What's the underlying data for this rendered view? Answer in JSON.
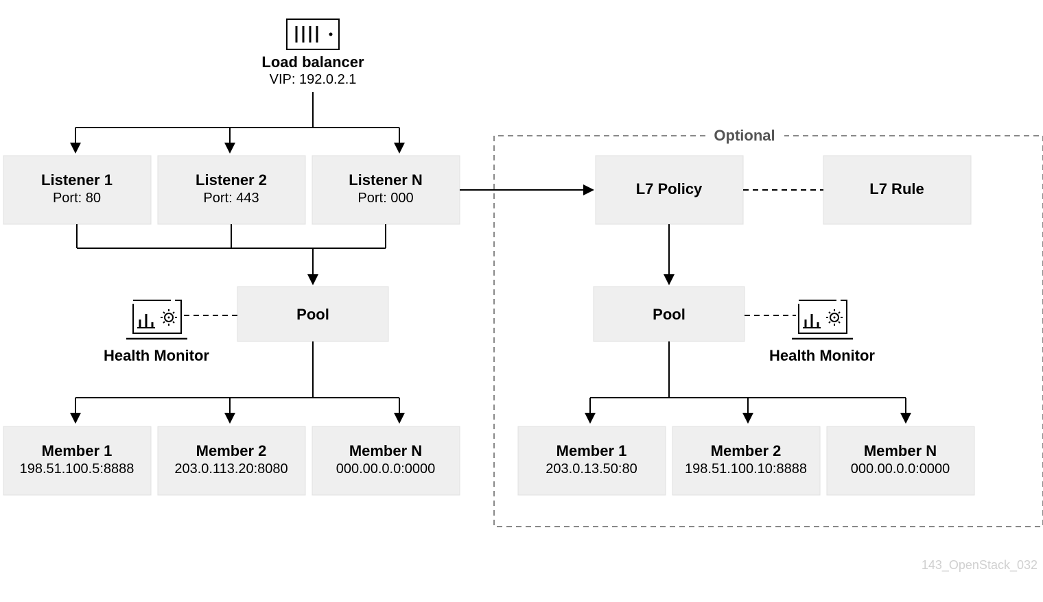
{
  "loadbalancer": {
    "title": "Load balancer",
    "sub": "VIP: 192.0.2.1"
  },
  "listeners": [
    {
      "title": "Listener 1",
      "sub": "Port: 80"
    },
    {
      "title": "Listener 2",
      "sub": "Port: 443"
    },
    {
      "title": "Listener N",
      "sub": "Port: 000"
    }
  ],
  "pool_left": {
    "title": "Pool"
  },
  "hm_left": "Health Monitor",
  "members_left": [
    {
      "title": "Member 1",
      "sub": "198.51.100.5:8888"
    },
    {
      "title": "Member 2",
      "sub": "203.0.113.20:8080"
    },
    {
      "title": "Member N",
      "sub": "000.00.0.0:0000"
    }
  ],
  "optional_label": "Optional",
  "l7policy": {
    "title": "L7 Policy"
  },
  "l7rule": {
    "title": "L7 Rule"
  },
  "pool_right": {
    "title": "Pool"
  },
  "hm_right": "Health Monitor",
  "members_right": [
    {
      "title": "Member 1",
      "sub": "203.0.13.50:80"
    },
    {
      "title": "Member 2",
      "sub": "198.51.100.10:8888"
    },
    {
      "title": "Member N",
      "sub": "000.00.0.0:0000"
    }
  ],
  "watermark": "143_OpenStack_032"
}
